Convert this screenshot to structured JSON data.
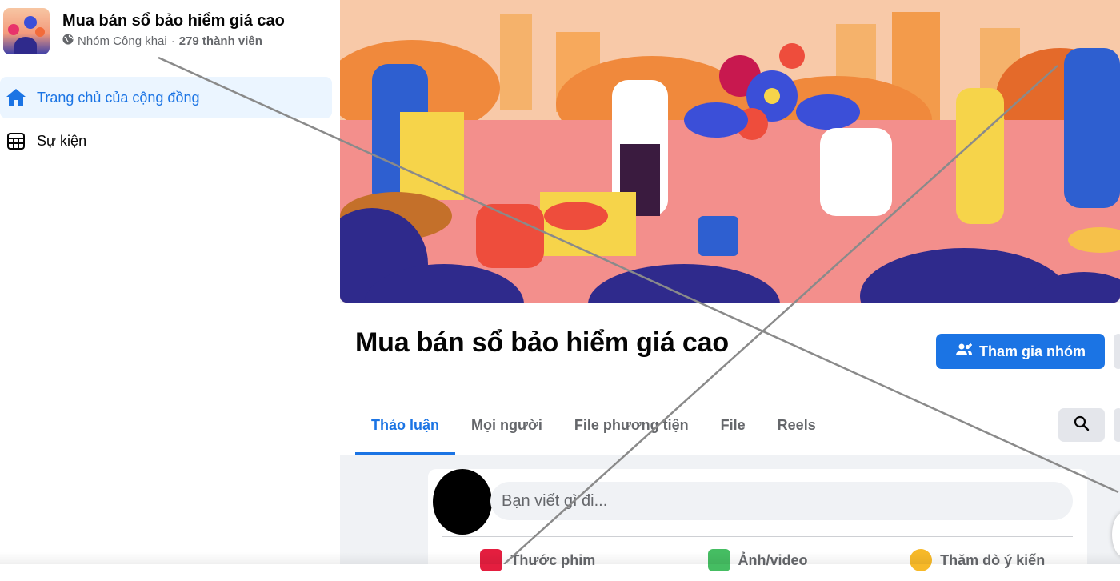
{
  "group": {
    "name": "Mua bán sổ bảo hiểm giá cao",
    "privacy": "Nhóm Công khai",
    "separator": "·",
    "members": "279 thành viên"
  },
  "sidebar": {
    "items": [
      {
        "label": "Trang chủ của cộng đồng",
        "icon": "home-icon",
        "active": true
      },
      {
        "label": "Sự kiện",
        "icon": "calendar-table-icon",
        "active": false
      }
    ]
  },
  "header": {
    "title": "Mua bán sổ bảo hiểm giá cao",
    "join_label": "Tham gia nhóm"
  },
  "tabs": [
    {
      "label": "Thảo luận",
      "active": true
    },
    {
      "label": "Mọi người",
      "active": false
    },
    {
      "label": "File phương tiện",
      "active": false
    },
    {
      "label": "File",
      "active": false
    },
    {
      "label": "Reels",
      "active": false
    }
  ],
  "composer": {
    "placeholder": "Bạn viết gì đi...",
    "actions": [
      {
        "label": "Thước phim",
        "icon": "reels-icon",
        "color": "#e41e3f"
      },
      {
        "label": "Ảnh/video",
        "icon": "photo-icon",
        "color": "#45bd62"
      },
      {
        "label": "Thăm dò ý kiến",
        "icon": "poll-icon",
        "color": "#f7b928"
      }
    ]
  },
  "colors": {
    "accent": "#1b74e4",
    "active_bg": "#ebf5ff",
    "page_bg": "#f0f2f5",
    "secondary_text": "#65676b"
  }
}
